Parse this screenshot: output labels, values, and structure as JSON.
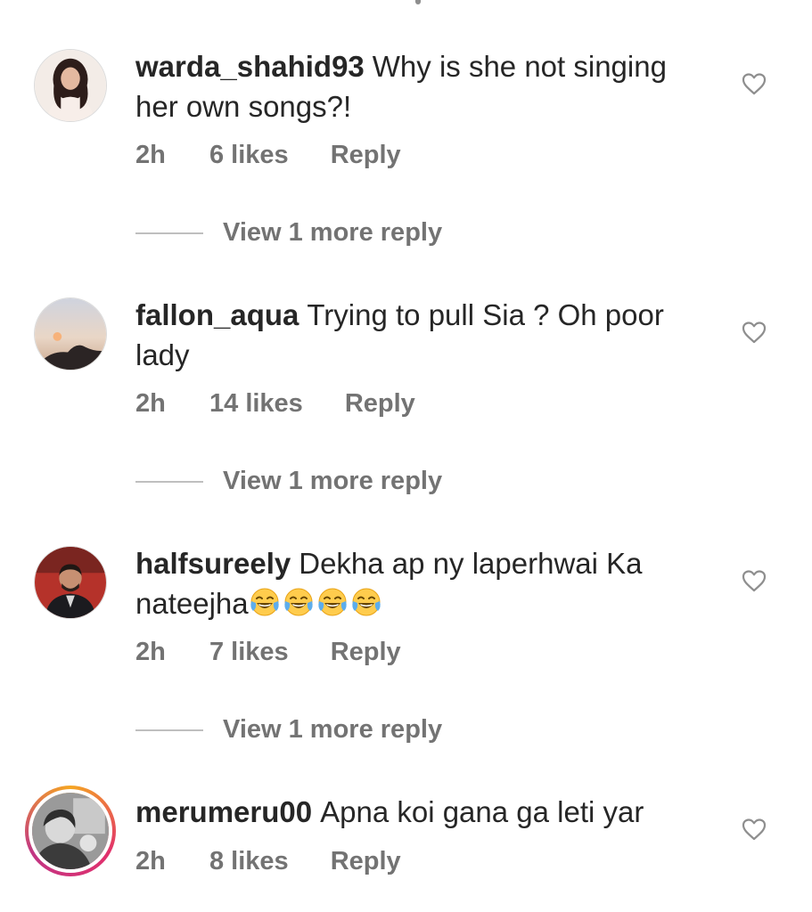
{
  "comments": [
    {
      "username": "warda_shahid93",
      "text": "Why is she not singing her own songs?!",
      "time": "2h",
      "likes": "6 likes",
      "reply_label": "Reply",
      "view_more": "View 1 more reply",
      "avatar_icon": "profile-photo",
      "story_ring": false
    },
    {
      "username": "fallon_aqua",
      "text": "Trying to pull Sia ? Oh poor lady",
      "time": "2h",
      "likes": "14 likes",
      "reply_label": "Reply",
      "view_more": "View 1 more reply",
      "avatar_icon": "profile-photo",
      "story_ring": false
    },
    {
      "username": "halfsureely",
      "text": "Dekha ap ny laperhwai Ka nateejha",
      "emoji_count": 4,
      "emoji_name": "face-with-tears-of-joy",
      "time": "2h",
      "likes": "7 likes",
      "reply_label": "Reply",
      "view_more": "View 1 more reply",
      "avatar_icon": "profile-photo",
      "story_ring": false
    },
    {
      "username": "merumeru00",
      "text": "Apna koi gana ga leti yar",
      "time": "2h",
      "likes": "8 likes",
      "reply_label": "Reply",
      "avatar_icon": "profile-photo",
      "story_ring": true
    }
  ],
  "icons": {
    "like": "heart-outline-icon"
  },
  "colors": {
    "text": "#262626",
    "secondary": "#737373",
    "divider": "#bfbfbf",
    "heart": "#8e8e8e"
  }
}
